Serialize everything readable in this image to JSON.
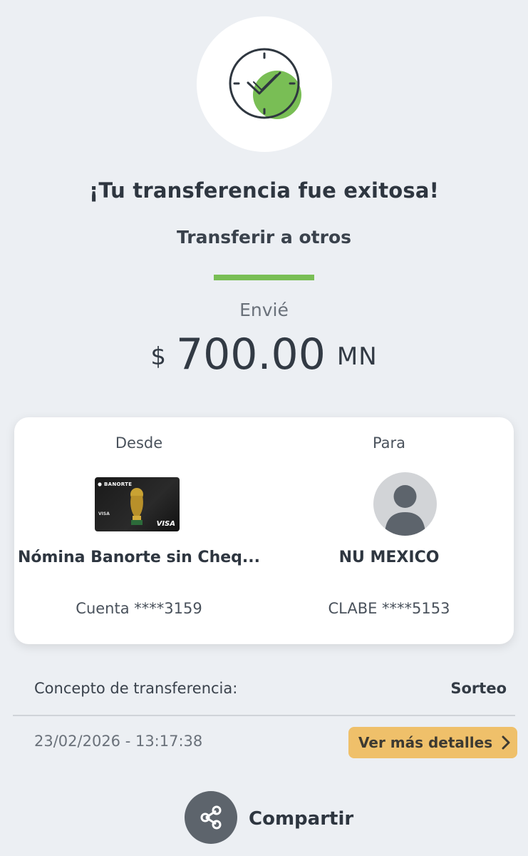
{
  "status": {
    "icon": "clock-check-icon",
    "title": "¡Tu transferencia fue exitosa!",
    "subtitle": "Transferir a otros"
  },
  "amount": {
    "label": "Envié",
    "currency_symbol": "$",
    "value": "700.00",
    "currency_code": "MN"
  },
  "transfer": {
    "from": {
      "label": "Desde",
      "card_brand": "BANORTE",
      "card_network": "VISA",
      "name": "Nómina Banorte sin Cheq...",
      "account": "Cuenta ****3159"
    },
    "to": {
      "label": "Para",
      "name": "NU MEXICO",
      "account": "CLABE ****5153"
    }
  },
  "concept": {
    "label": "Concepto de transferencia:",
    "value": "Sorteo"
  },
  "datetime": "23/02/2026 - 13:17:38",
  "details_button": "Ver más detalles",
  "share_label": "Compartir",
  "colors": {
    "background": "#eceff3",
    "accent_green": "#79be55",
    "details_button": "#efc06a",
    "share_button": "#5d646c"
  }
}
